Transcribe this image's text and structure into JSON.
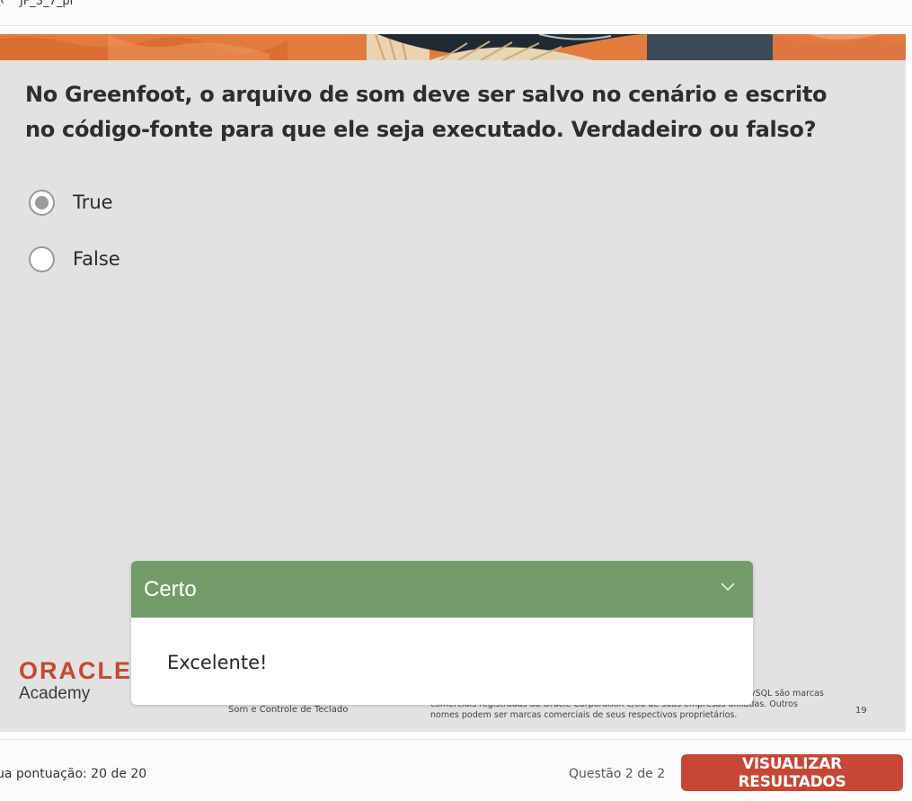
{
  "window": {
    "breadcrumb_arrow": "‹",
    "title": "JF_3_7_pr"
  },
  "question": {
    "text": " No Greenfoot, o arquivo de som deve ser salvo no cenário e escrito no código-fonte para que ele seja executado. Verdadeiro ou falso?",
    "options": [
      {
        "label": "True",
        "selected": true
      },
      {
        "label": "False",
        "selected": false
      }
    ]
  },
  "slide_footer": {
    "logo_text": "ORACLE",
    "logo_sub": "Academy",
    "subject": "Som e Controle de Teclado",
    "legal_line1": "ySQL são marcas",
    "legal_line2": "comerciais registradas da Oracle Corporation e/ou de suas empresas afiliadas. Outros",
    "legal_line3": "nomes podem ser marcas comerciais de seus respectivos proprietários.",
    "page_number": "19"
  },
  "feedback": {
    "title": "Certo",
    "message": "Excelente!",
    "header_color": "#739c6a"
  },
  "footer": {
    "score": "ua pontuação: 20 de 20",
    "question_count": "Questão 2 de 2",
    "results_button": "VISUALIZAR RESULTADOS"
  },
  "colors": {
    "accent": "#c74634",
    "banner": "#e27b3c",
    "slide_bg": "#e1e2e1"
  },
  "icons": {
    "feedback_toggle": "chevron-down-icon"
  }
}
